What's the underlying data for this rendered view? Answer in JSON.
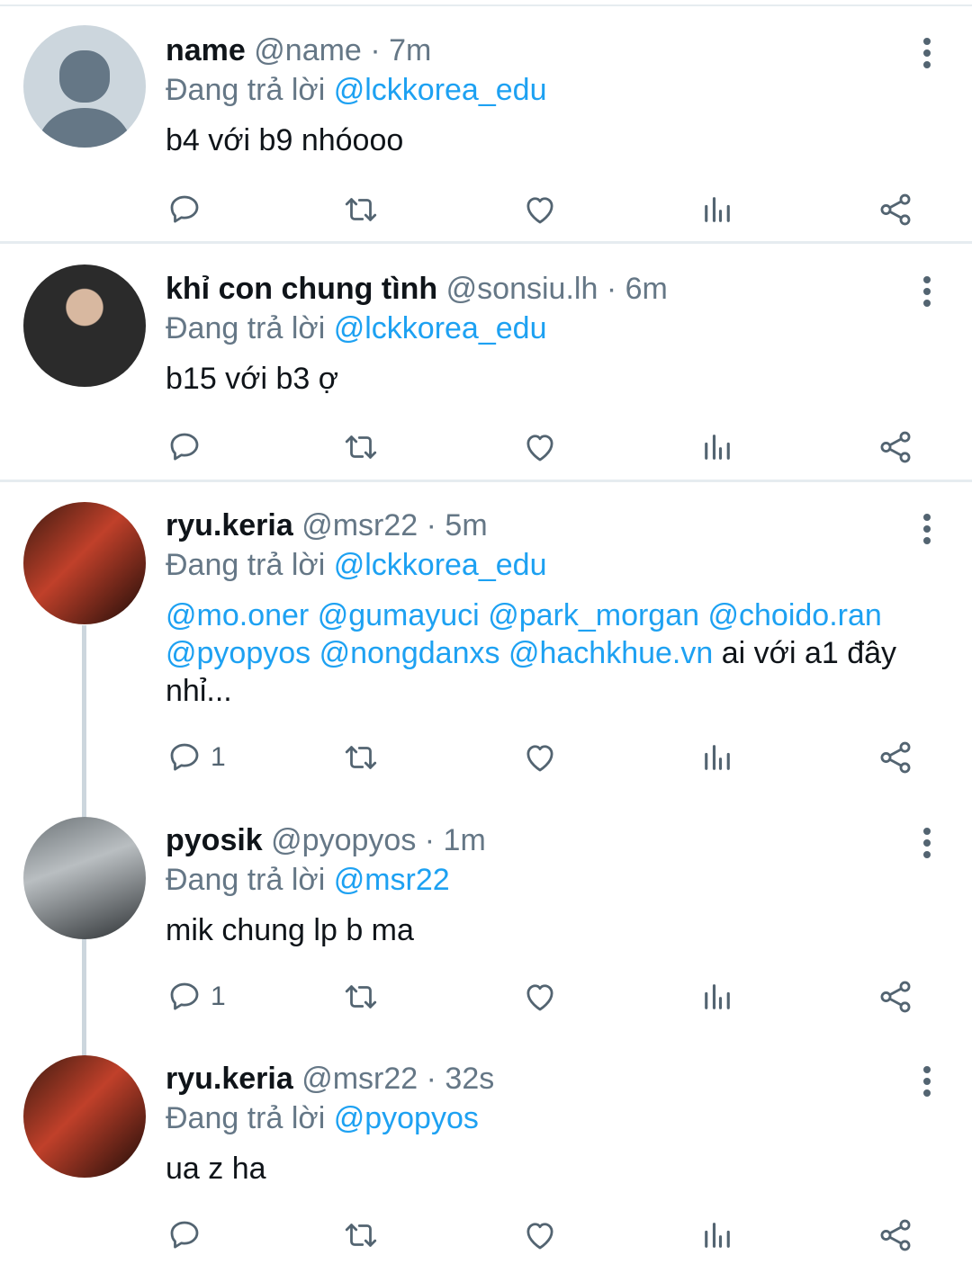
{
  "reply_prefix": "Đang trả lời",
  "colors": {
    "accent": "#1da1f2",
    "muted": "#657786",
    "text": "#0f1419",
    "divider": "#e6ecf0"
  },
  "icons": [
    "more-vert-icon",
    "reply-icon",
    "retweet-icon",
    "like-icon",
    "analytics-icon",
    "share-icon"
  ],
  "tweets": [
    {
      "name": "name",
      "handle": "@name",
      "time": "· 7m",
      "reply_to": "@lckkorea_edu",
      "text": "b4 với b9 nhóooo",
      "reply_count": ""
    },
    {
      "name": "khỉ con chung tình",
      "handle": "@sonsiu.lh",
      "time": "· 6m",
      "reply_to": "@lckkorea_edu",
      "text": "b15 với b3 ợ",
      "reply_count": ""
    },
    {
      "name": "ryu.keria",
      "handle": "@msr22",
      "time": "· 5m",
      "reply_to": "@lckkorea_edu",
      "mentions": [
        "@mo.oner",
        "@gumayuci",
        "@park_morgan",
        "@choido.ran",
        "@pyopyos",
        "@nongdanxs",
        "@hachkhue.vn"
      ],
      "text_after": "ai với a1 đây",
      "text_end": "nhỉ...",
      "reply_count": "1"
    },
    {
      "name": "pyosik",
      "handle": "@pyopyos",
      "time": "· 1m",
      "reply_to": "@msr22",
      "text": "mik chung lp b ma",
      "reply_count": "1"
    },
    {
      "name": "ryu.keria",
      "handle": "@msr22",
      "time": "· 32s",
      "reply_to": "@pyopyos",
      "text": "ua z ha",
      "reply_count": ""
    }
  ]
}
